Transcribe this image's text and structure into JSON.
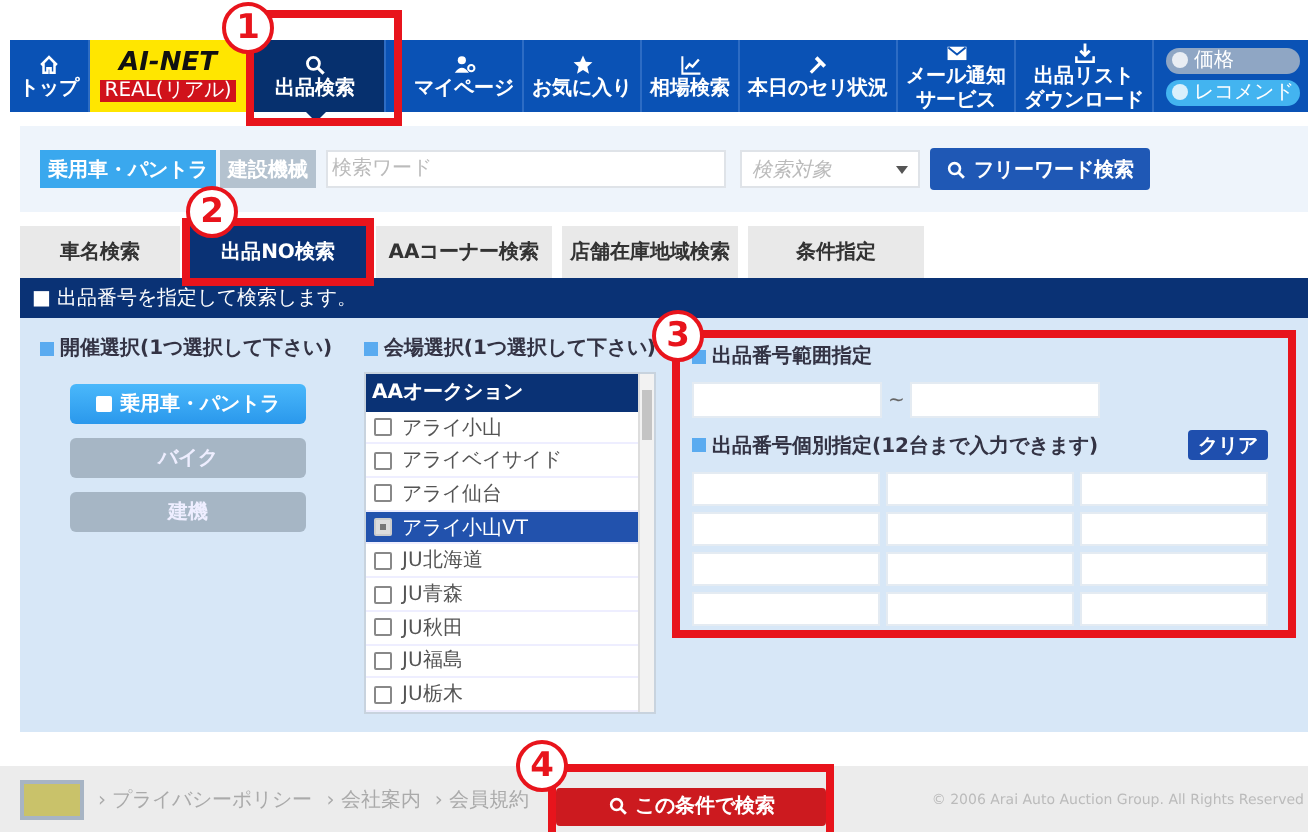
{
  "nav": {
    "items": [
      {
        "kind": "home",
        "lines": [
          "トップ"
        ],
        "selected": false
      },
      {
        "kind": "logo",
        "lines": [
          "AI-NET",
          "REAL(リアル)"
        ]
      },
      {
        "kind": "search",
        "lines": [
          "出品検索"
        ],
        "selected": true,
        "callout": "1"
      },
      {
        "kind": "user",
        "lines": [
          "マイページ"
        ],
        "selected": false
      },
      {
        "kind": "star",
        "lines": [
          "お気に入り"
        ],
        "selected": false
      },
      {
        "kind": "chart",
        "lines": [
          "相場検索"
        ],
        "selected": false
      },
      {
        "kind": "hammer",
        "lines": [
          "本日のセリ状況"
        ],
        "selected": false
      },
      {
        "kind": "mail",
        "lines": [
          "メール通知",
          "サービス"
        ],
        "selected": false
      },
      {
        "kind": "download",
        "lines": [
          "出品リスト",
          "ダウンロード"
        ],
        "selected": false
      }
    ],
    "toggles": [
      {
        "label": "価格",
        "on": false
      },
      {
        "label": "レコメンド",
        "on": true
      }
    ]
  },
  "freeword": {
    "categories": [
      {
        "label": "乗用車・パントラ",
        "selected": true
      },
      {
        "label": "建設機械",
        "selected": false
      }
    ],
    "placeholder": "検索ワード",
    "target_placeholder": "検索対象",
    "button": "フリーワード検索"
  },
  "tabs": [
    {
      "label": "車名検索",
      "selected": false
    },
    {
      "label": "出品NO検索",
      "selected": true,
      "callout": "2"
    },
    {
      "label": "AAコーナー検索",
      "selected": false
    },
    {
      "label": "店舗在庫地域検索",
      "selected": false
    },
    {
      "label": "条件指定",
      "selected": false
    }
  ],
  "info": "■ 出品番号を指定して検索します。",
  "event": {
    "heading": "開催選択(1つ選択して下さい)",
    "options": [
      {
        "label": "乗用車・パントラ",
        "selected": true
      },
      {
        "label": "バイク",
        "selected": false
      },
      {
        "label": "建機",
        "selected": false
      }
    ]
  },
  "venue": {
    "heading": "会場選択(1つ選択して下さい)",
    "group": "AAオークション",
    "items": [
      {
        "label": "アライ小山",
        "checked": false
      },
      {
        "label": "アライベイサイド",
        "checked": false
      },
      {
        "label": "アライ仙台",
        "checked": false
      },
      {
        "label": "アライ小山VT",
        "checked": true
      },
      {
        "label": "JU北海道",
        "checked": false
      },
      {
        "label": "JU青森",
        "checked": false
      },
      {
        "label": "JU秋田",
        "checked": false
      },
      {
        "label": "JU福島",
        "checked": false
      },
      {
        "label": "JU栃木",
        "checked": false
      }
    ]
  },
  "number": {
    "callout": "3",
    "range_heading": "出品番号範囲指定",
    "separator": "~",
    "individual_heading": "出品番号個別指定(12台まで入力できます)",
    "clear": "クリア"
  },
  "footer": {
    "links": [
      "› プライバシーポリシー",
      "› 会社案内",
      "› 会員規約"
    ],
    "search": {
      "label": "この条件で検索",
      "callout": "4"
    },
    "copyright": "© 2006 Arai Auto Auction Group. All Rights Reserved"
  }
}
